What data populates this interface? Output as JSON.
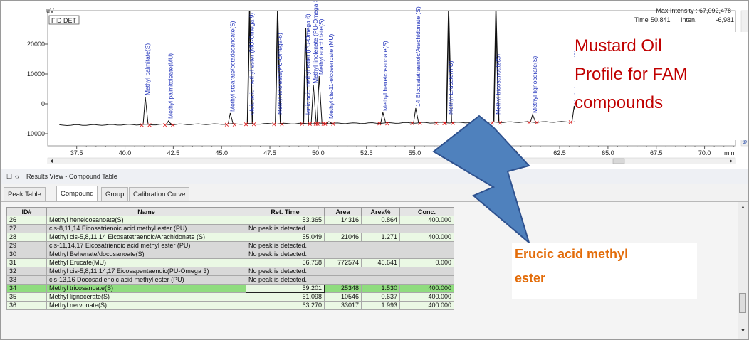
{
  "window": {
    "title": "Results View - Compound Table"
  },
  "chromatogram": {
    "y_unit": "uV",
    "detector": "FID DET",
    "max_intensity_label": "Max Intensity : 67,092,478",
    "cursor_time_label": "Time",
    "cursor_time_value": "50.841",
    "cursor_inten_label": "Inten.",
    "cursor_inten_value": "-6,981",
    "x_unit": "min",
    "x_ticks": [
      "37.5",
      "40.0",
      "42.5",
      "45.0",
      "47.5",
      "50.0",
      "52.5",
      "55.0",
      "60.0",
      "62.5",
      "65.0",
      "67.5",
      "70.0"
    ],
    "y_ticks": [
      "20000",
      "10000",
      "0",
      "-10000"
    ],
    "peak_labels": [
      "Methyl palmitate(S)",
      "Methyl palmitoleate(MU)",
      "Methyl stearate/octadecanoate(S)",
      "oleic acid methyl ester (MU-Omega 9)",
      "Methyl linoleate(PU-Omega-6)",
      "lenic acid methyl ester (PU-Omega 6)",
      "Methyl linolenate (PU-Omega 3)",
      "Methyl arachidate(S)",
      "Methyl cis-11-eicosenoate (MU)",
      "Methyl heneicosanoate(S)",
      "14 Eicosatetraenoic/Arachidonate (S)",
      "Methyl Erucate(MU)",
      "Methyl tricosanoate(S)",
      "Methyl lignocerate(S)",
      "Methyl nervonate(S)"
    ]
  },
  "callout_title": {
    "lines": [
      "Mustard Oil",
      "Profile for FAM",
      "compounds"
    ],
    "color": "#c00000"
  },
  "callout_erucic": {
    "lines": [
      "Erucic acid methyl",
      "ester"
    ],
    "color": "#e36c09"
  },
  "arrow_color": "#4f81bd",
  "tabs": [
    {
      "label": "Peak Table",
      "active": false
    },
    {
      "label": "Compound",
      "active": true
    },
    {
      "label": "Group",
      "active": false
    },
    {
      "label": "Calibration Curve",
      "active": false
    }
  ],
  "table": {
    "columns": [
      "ID#",
      "Name",
      "Ret. Time",
      "Area",
      "Area%",
      "Conc."
    ],
    "rows": [
      {
        "id": "26",
        "name": "Methyl heneicosanoate(S)",
        "ret": "53.365",
        "area": "14316",
        "areapct": "0.864",
        "conc": "400.000",
        "state": "peak"
      },
      {
        "id": "27",
        "name": "cis-8,11,14 Eicosatrienoic acid methyl ester (PU)",
        "ret": "No peak is detected.",
        "area": "",
        "areapct": "",
        "conc": "",
        "state": "nopeak"
      },
      {
        "id": "28",
        "name": "Methyl cis-5,8,11,14 Eicosatetraenoic/Arachidonate (S)",
        "ret": "55.049",
        "area": "21046",
        "areapct": "1.271",
        "conc": "400.000",
        "state": "peak"
      },
      {
        "id": "29",
        "name": "cis-11,14,17 Eicosatrienoic acid methyl ester (PU)",
        "ret": "No peak is detected.",
        "area": "",
        "areapct": "",
        "conc": "",
        "state": "nopeak"
      },
      {
        "id": "30",
        "name": "Methyl Behenate/docosanoate(S)",
        "ret": "No peak is detected.",
        "area": "",
        "areapct": "",
        "conc": "",
        "state": "nopeak"
      },
      {
        "id": "31",
        "name": "Methyl Erucate(MU)",
        "ret": "56.758",
        "area": "772574",
        "areapct": "46.641",
        "conc": "0.000",
        "state": "peak"
      },
      {
        "id": "32",
        "name": "Methyl cis-5,8,11,14,17 Eicosapentaenoic(PU-Omega 3)",
        "ret": "No peak is detected.",
        "area": "",
        "areapct": "",
        "conc": "",
        "state": "nopeak"
      },
      {
        "id": "33",
        "name": "cis-13,16 Docosadienoic acid methyl ester (PU)",
        "ret": "No peak is detected.",
        "area": "",
        "areapct": "",
        "conc": "",
        "state": "nopeak"
      },
      {
        "id": "34",
        "name": "Methyl tricosanoate(S)",
        "ret": "59.201",
        "area": "25348",
        "areapct": "1.530",
        "conc": "400.000",
        "state": "selected"
      },
      {
        "id": "35",
        "name": "Methyl lignocerate(S)",
        "ret": "61.098",
        "area": "10546",
        "areapct": "0.637",
        "conc": "400.000",
        "state": "peak"
      },
      {
        "id": "36",
        "name": "Methyl nervonate(S)",
        "ret": "63.270",
        "area": "33017",
        "areapct": "1.993",
        "conc": "400.000",
        "state": "peak"
      }
    ]
  },
  "icons": {
    "panel_toggle": "square-icon",
    "nav": "double-chevron-icon",
    "scroll_up": "triangle-up-icon",
    "scroll_down": "triangle-down-icon",
    "scroll_left": "triangle-left-icon",
    "scroll_right": "triangle-right-icon",
    "zoom": "zoom-icon"
  }
}
